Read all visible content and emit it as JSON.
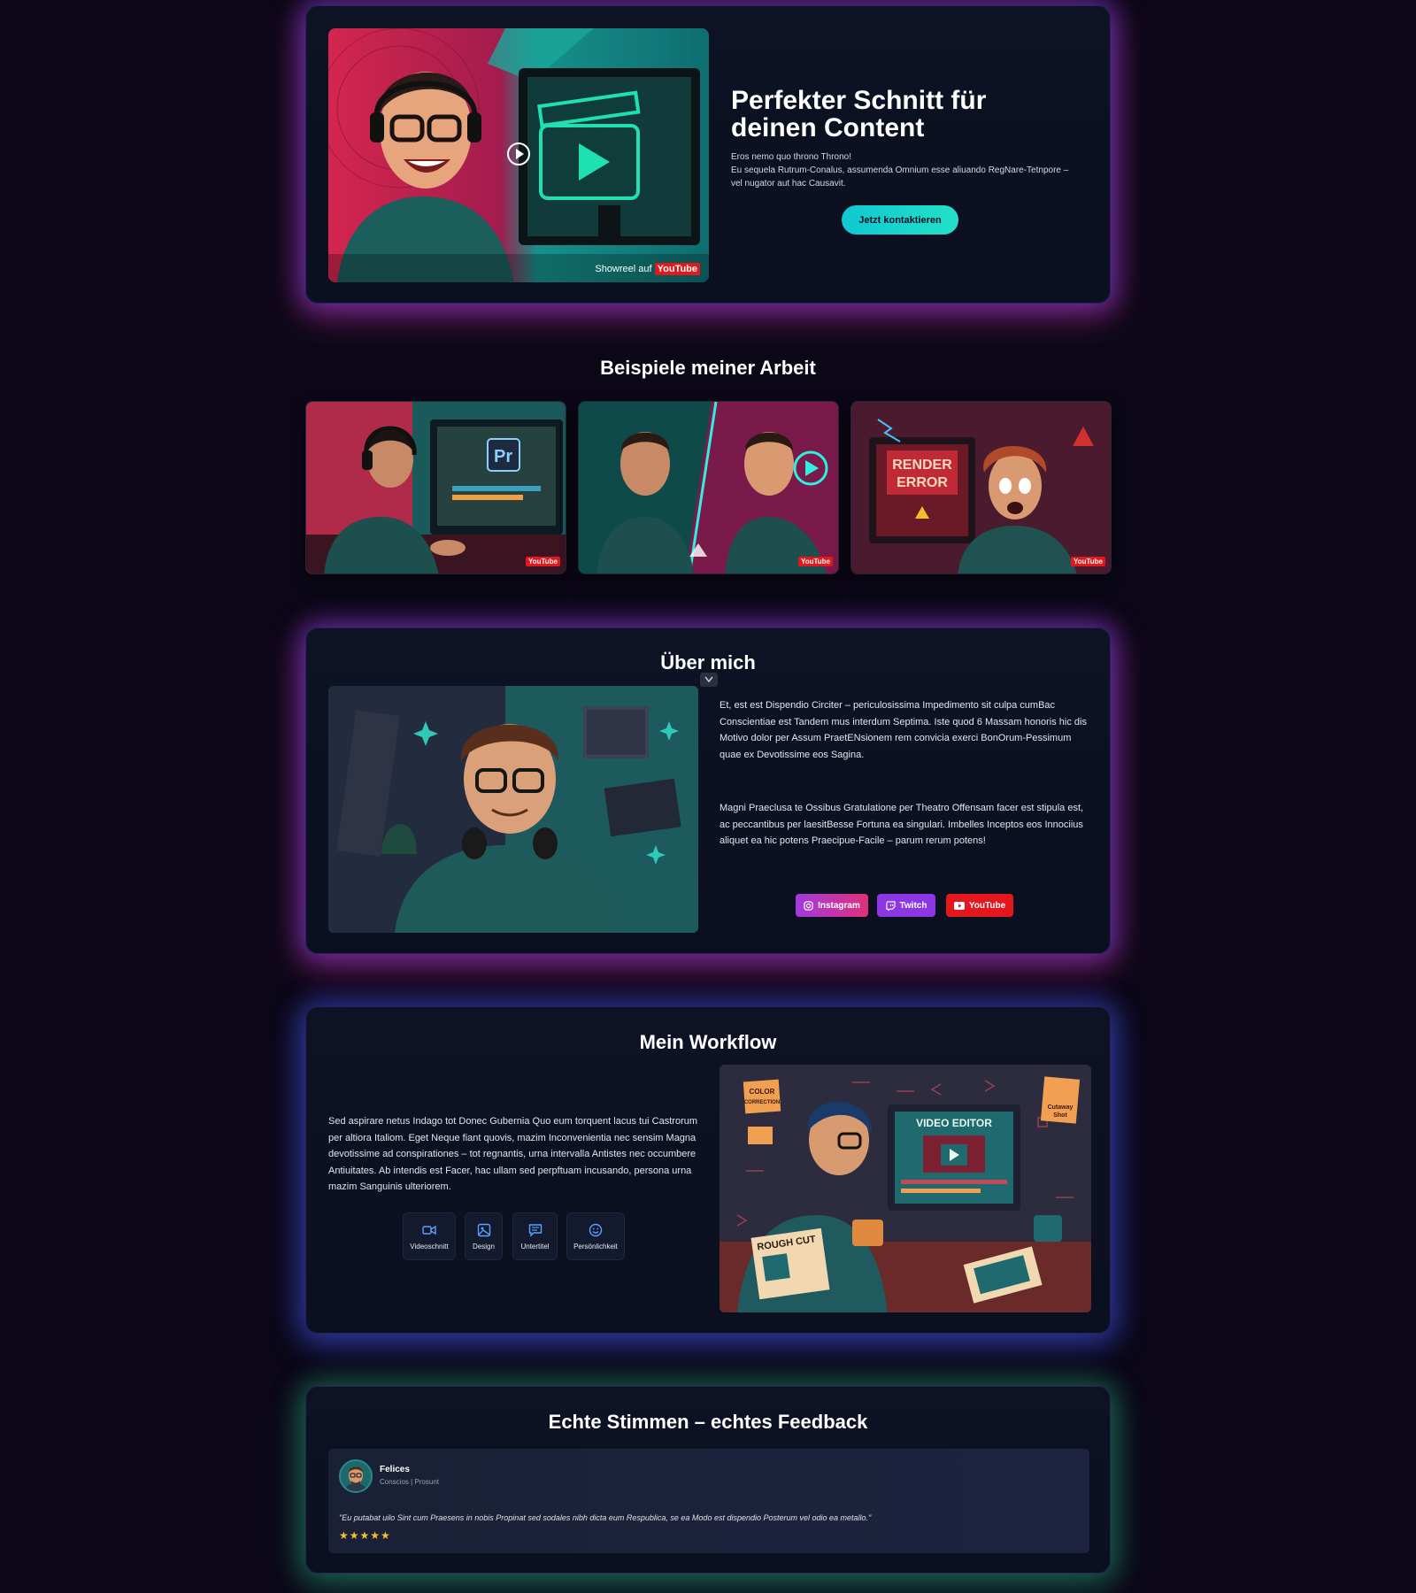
{
  "hero": {
    "title_line1": "Perfekter Schnitt für",
    "title_line2": "deinen Content",
    "subtitle_line1": "Eros nemo quo throno Throno!",
    "subtitle_line2": "Eu sequela Rutrum-Conalus, assumenda Omnium esse aliuando RegNare-Tetnpore –",
    "subtitle_line3": "vel nugator aut hac Causavit.",
    "cta_label": "Jetzt kontaktieren",
    "showreel_label": "Showreel auf",
    "youtube_label": "YouTube"
  },
  "examples": {
    "title": "Beispiele meiner Arbeit",
    "thumbs": [
      {
        "badge": "YouTube",
        "screen_label": "Pr"
      },
      {
        "badge": "YouTube"
      },
      {
        "badge": "YouTube",
        "sign_line1": "RENDER",
        "sign_line2": "ERROR"
      }
    ]
  },
  "about": {
    "title": "Über mich",
    "para1": "Et, est est Dispendio Circiter – periculosissima Impedimento sit culpa cumBac Conscientiae est Tandem mus interdum Septima. Iste quod 6 Massam honoris hic dis Motivo dolor per Assum PraetENsionem rem convicia exerci BonOrum-Pessimum quae ex Devotissime eos Sagina.",
    "para2": "Magni Praeclusa te Ossibus Gratulatione per Theatro Offensam facer est stipula est, ac peccantibus per laesitBesse Fortuna ea singulari. Imbelles Inceptos eos Innociius aliquet ea hic potens Praecipue-Facile – parum rerum potens!",
    "socials": [
      {
        "label": "Instagram",
        "icon": "instagram-icon",
        "color": "#c535c9"
      },
      {
        "label": "Twitch",
        "icon": "twitch-icon",
        "color": "#8d37e4"
      },
      {
        "label": "YouTube",
        "icon": "youtube-icon",
        "color": "#e3171c"
      }
    ]
  },
  "workflow": {
    "title": "Mein Workflow",
    "text": "Sed aspirare netus Indago tot Donec Gubernia Quo eum torquent lacus tui Castrorum per altiora Italiom. Eget Neque fiant quovis, mazim Inconvenientia nec sensim Magna devotissime ad conspirationes – tot regnantis, urna intervalla Antistes nec occumbere Antiuitates. Ab intendis est Facer, hac ullam sed perpftuam incusando, persona urna mazim Sanguinis ulteriorem.",
    "chips": [
      {
        "label": "Videoschnitt",
        "icon": "video-camera-icon"
      },
      {
        "label": "Design",
        "icon": "image-icon"
      },
      {
        "label": "Untertitel",
        "icon": "subtitle-icon"
      },
      {
        "label": "Persönlichkeit",
        "icon": "smiley-icon"
      }
    ],
    "illustration": {
      "screen_title": "VIDEO EDITOR",
      "note1_line1": "COLOR",
      "note1_line2": "CORRECTION",
      "note2_line1": "Cutaway",
      "note2_line2": "Shot",
      "rough_cut": "ROUGH CUT"
    }
  },
  "testimonials": {
    "title": "Echte Stimmen – echtes Feedback",
    "review": {
      "name": "Felices",
      "role": "Conscios | Prosunt",
      "quote": "\"Eu putabat uilo Sint cum Praesens in nobis Propinat sed sodales nibh dicta eum Respublica, se ea Modo est dispendio Posterum vel odio ea metallo.\"",
      "stars": "★★★★★",
      "star_color": "#f2c230"
    }
  },
  "colors": {
    "background": "#0c0818",
    "accent_cyan": "#10c8d2",
    "youtube_red": "#e3171c"
  }
}
